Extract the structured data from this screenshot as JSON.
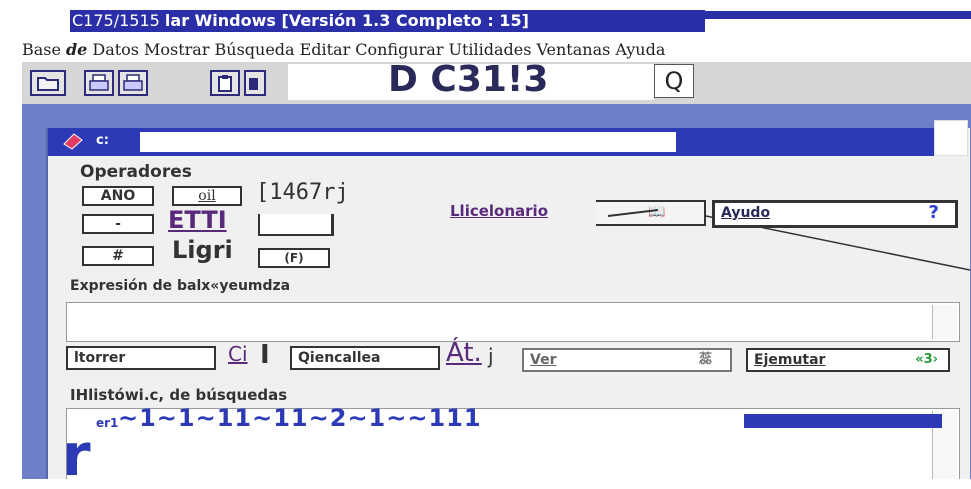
{
  "window": {
    "title_part1": "C175/1515 ",
    "title_part2": "lar Windows [Versión 1.3 Completo : 15]"
  },
  "menu": {
    "items": [
      "Base",
      "de",
      "Datos",
      "Mostrar",
      "Búsqueda",
      "Editar",
      "Configurar",
      "Utilidades",
      "Ventanas",
      "Ayuda"
    ]
  },
  "toolbar": {
    "heading": "D C31!3",
    "search_glyph": "Q"
  },
  "dialog": {
    "caption_label": "c:",
    "operators_title": "Operadores",
    "op_and": "ANO",
    "op_oil": "oil",
    "op_bracket_text": "[1467rj",
    "op_dash": "-",
    "op_etti": "ETTI",
    "op_hash": "#",
    "op_ligri": "Ligri",
    "op_f": "(F)",
    "dictionary_label": "Llicelonario",
    "help_label": "Ayudo",
    "help_glyph": "?",
    "expression_label": "Expresión de balx«yeumdza",
    "clear_label": "ltorrer",
    "ci_text": "Ci",
    "sep_glyph": "I",
    "cancel_label": "Qiencallea",
    "at_text": "Át.",
    "j_text": "j",
    "view_label": "Ver",
    "view_glyph": "蕊",
    "execute_label": "Ejemutar",
    "execute_badge": "«3›",
    "history_label": "IHlistówi.c, de búsquedas",
    "history_prefix": "er1",
    "history_text": "~1~1~11~11~2~1~~111",
    "bottom_glyph": "r"
  }
}
